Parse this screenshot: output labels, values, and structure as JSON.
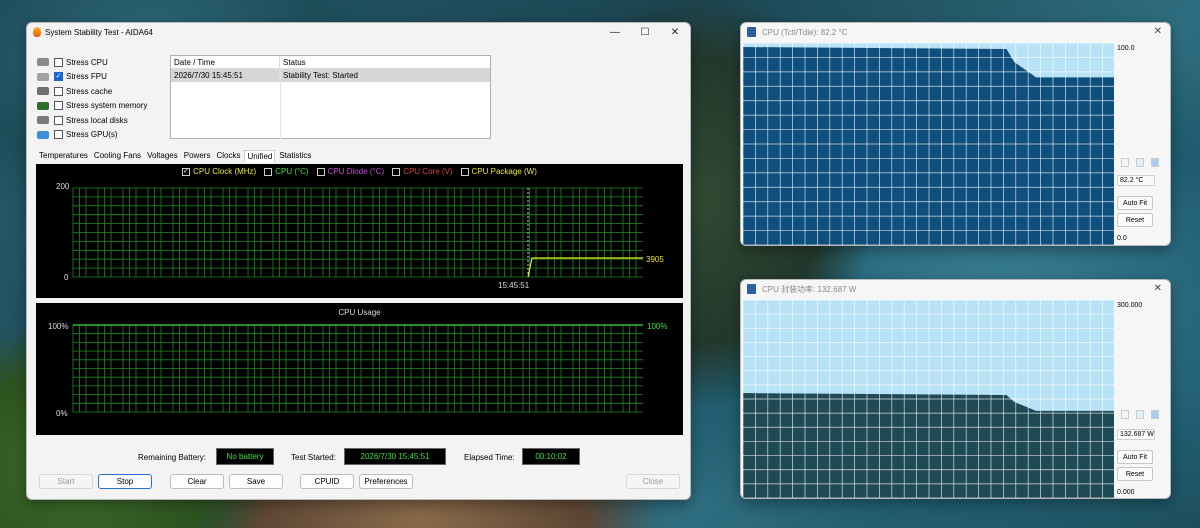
{
  "main_window": {
    "title": "System Stability Test - AIDA64",
    "stress_items": [
      {
        "label": "Stress CPU",
        "checked": false
      },
      {
        "label": "Stress FPU",
        "checked": true
      },
      {
        "label": "Stress cache",
        "checked": false
      },
      {
        "label": "Stress system memory",
        "checked": false
      },
      {
        "label": "Stress local disks",
        "checked": false
      },
      {
        "label": "Stress GPU(s)",
        "checked": false
      }
    ],
    "log": {
      "col_datetime": "Date / Time",
      "col_status": "Status",
      "rows": [
        {
          "datetime": "2026/7/30 15:45:51",
          "status": "Stability Test: Started"
        }
      ]
    },
    "tabs": [
      "Temperatures",
      "Cooling Fans",
      "Voltages",
      "Powers",
      "Clocks",
      "Unified",
      "Statistics"
    ],
    "active_tab": "Unified",
    "graph1": {
      "legend": [
        {
          "label": "CPU Clock (MHz)",
          "checked": true,
          "color": "#e8e830"
        },
        {
          "label": "CPU (°C)",
          "checked": false,
          "color": "#3ee03e"
        },
        {
          "label": "CPU Diode (°C)",
          "checked": false,
          "color": "#d04ad0"
        },
        {
          "label": "CPU Core (V)",
          "checked": false,
          "color": "#e04040"
        },
        {
          "label": "CPU Package (W)",
          "checked": false,
          "color": "#e8e830"
        }
      ],
      "y_max": "200",
      "y_min": "0",
      "time_label": "15:45:51",
      "current_value": "3905"
    },
    "graph2": {
      "title": "CPU Usage",
      "y_max": "100%",
      "y_min": "0%",
      "current_value": "100%"
    },
    "status": {
      "battery_label": "Remaining Battery:",
      "battery_value": "No battery",
      "started_label": "Test Started:",
      "started_value": "2026/7/30 15:45:51",
      "elapsed_label": "Elapsed Time:",
      "elapsed_value": "00:10:02"
    },
    "buttons": {
      "start": "Start",
      "stop": "Stop",
      "clear": "Clear",
      "save": "Save",
      "cpuid": "CPUID",
      "preferences": "Preferences",
      "close": "Close"
    }
  },
  "sensor_temp": {
    "title": "CPU (Tctl/Tdie): 82.2 °C",
    "top_value": "100.0",
    "current_value": "82.2 °C",
    "bottom_value": "0.0",
    "auto_fit": "Auto Fit",
    "reset": "Reset",
    "level_start": 0.98,
    "level_end": 0.83
  },
  "sensor_power": {
    "title": "CPU 封装功率: 132.687 W",
    "top_value": "300.000",
    "current_value": "132.687 W",
    "bottom_value": "0.000",
    "auto_fit": "Auto Fit",
    "reset": "Reset",
    "level_start": 0.53,
    "level_end": 0.44
  },
  "colors": {
    "graph_grid": "#1f8a1f",
    "graph_bg": "#000000",
    "value_green": "#3ee03e",
    "sensor_fill_temp": "#0e4f7e",
    "sensor_fill_power": "#1f4a55",
    "sensor_bg": "#b8e3f6"
  }
}
